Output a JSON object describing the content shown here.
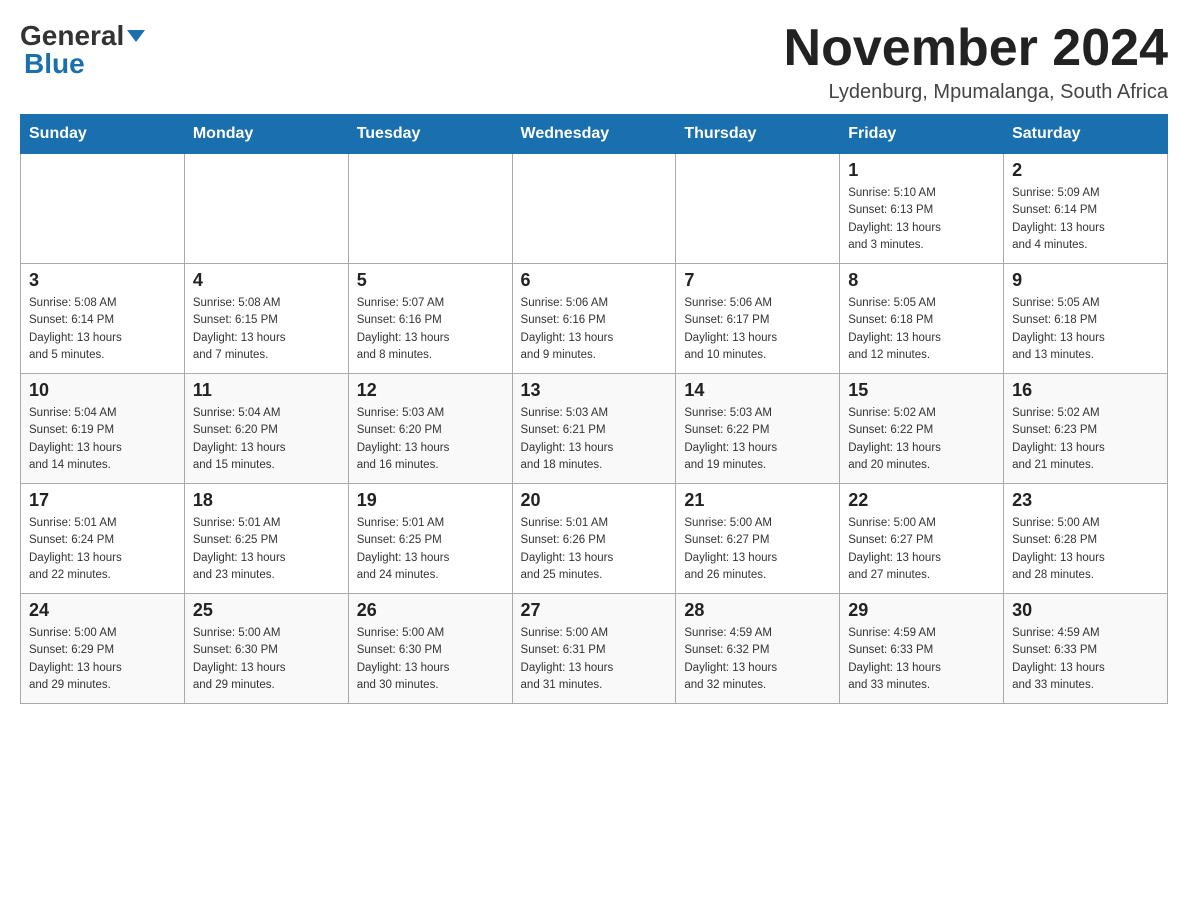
{
  "header": {
    "logo_general": "General",
    "logo_blue": "Blue",
    "month_title": "November 2024",
    "location": "Lydenburg, Mpumalanga, South Africa"
  },
  "weekdays": [
    "Sunday",
    "Monday",
    "Tuesday",
    "Wednesday",
    "Thursday",
    "Friday",
    "Saturday"
  ],
  "weeks": [
    [
      {
        "day": "",
        "info": ""
      },
      {
        "day": "",
        "info": ""
      },
      {
        "day": "",
        "info": ""
      },
      {
        "day": "",
        "info": ""
      },
      {
        "day": "",
        "info": ""
      },
      {
        "day": "1",
        "info": "Sunrise: 5:10 AM\nSunset: 6:13 PM\nDaylight: 13 hours\nand 3 minutes."
      },
      {
        "day": "2",
        "info": "Sunrise: 5:09 AM\nSunset: 6:14 PM\nDaylight: 13 hours\nand 4 minutes."
      }
    ],
    [
      {
        "day": "3",
        "info": "Sunrise: 5:08 AM\nSunset: 6:14 PM\nDaylight: 13 hours\nand 5 minutes."
      },
      {
        "day": "4",
        "info": "Sunrise: 5:08 AM\nSunset: 6:15 PM\nDaylight: 13 hours\nand 7 minutes."
      },
      {
        "day": "5",
        "info": "Sunrise: 5:07 AM\nSunset: 6:16 PM\nDaylight: 13 hours\nand 8 minutes."
      },
      {
        "day": "6",
        "info": "Sunrise: 5:06 AM\nSunset: 6:16 PM\nDaylight: 13 hours\nand 9 minutes."
      },
      {
        "day": "7",
        "info": "Sunrise: 5:06 AM\nSunset: 6:17 PM\nDaylight: 13 hours\nand 10 minutes."
      },
      {
        "day": "8",
        "info": "Sunrise: 5:05 AM\nSunset: 6:18 PM\nDaylight: 13 hours\nand 12 minutes."
      },
      {
        "day": "9",
        "info": "Sunrise: 5:05 AM\nSunset: 6:18 PM\nDaylight: 13 hours\nand 13 minutes."
      }
    ],
    [
      {
        "day": "10",
        "info": "Sunrise: 5:04 AM\nSunset: 6:19 PM\nDaylight: 13 hours\nand 14 minutes."
      },
      {
        "day": "11",
        "info": "Sunrise: 5:04 AM\nSunset: 6:20 PM\nDaylight: 13 hours\nand 15 minutes."
      },
      {
        "day": "12",
        "info": "Sunrise: 5:03 AM\nSunset: 6:20 PM\nDaylight: 13 hours\nand 16 minutes."
      },
      {
        "day": "13",
        "info": "Sunrise: 5:03 AM\nSunset: 6:21 PM\nDaylight: 13 hours\nand 18 minutes."
      },
      {
        "day": "14",
        "info": "Sunrise: 5:03 AM\nSunset: 6:22 PM\nDaylight: 13 hours\nand 19 minutes."
      },
      {
        "day": "15",
        "info": "Sunrise: 5:02 AM\nSunset: 6:22 PM\nDaylight: 13 hours\nand 20 minutes."
      },
      {
        "day": "16",
        "info": "Sunrise: 5:02 AM\nSunset: 6:23 PM\nDaylight: 13 hours\nand 21 minutes."
      }
    ],
    [
      {
        "day": "17",
        "info": "Sunrise: 5:01 AM\nSunset: 6:24 PM\nDaylight: 13 hours\nand 22 minutes."
      },
      {
        "day": "18",
        "info": "Sunrise: 5:01 AM\nSunset: 6:25 PM\nDaylight: 13 hours\nand 23 minutes."
      },
      {
        "day": "19",
        "info": "Sunrise: 5:01 AM\nSunset: 6:25 PM\nDaylight: 13 hours\nand 24 minutes."
      },
      {
        "day": "20",
        "info": "Sunrise: 5:01 AM\nSunset: 6:26 PM\nDaylight: 13 hours\nand 25 minutes."
      },
      {
        "day": "21",
        "info": "Sunrise: 5:00 AM\nSunset: 6:27 PM\nDaylight: 13 hours\nand 26 minutes."
      },
      {
        "day": "22",
        "info": "Sunrise: 5:00 AM\nSunset: 6:27 PM\nDaylight: 13 hours\nand 27 minutes."
      },
      {
        "day": "23",
        "info": "Sunrise: 5:00 AM\nSunset: 6:28 PM\nDaylight: 13 hours\nand 28 minutes."
      }
    ],
    [
      {
        "day": "24",
        "info": "Sunrise: 5:00 AM\nSunset: 6:29 PM\nDaylight: 13 hours\nand 29 minutes."
      },
      {
        "day": "25",
        "info": "Sunrise: 5:00 AM\nSunset: 6:30 PM\nDaylight: 13 hours\nand 29 minutes."
      },
      {
        "day": "26",
        "info": "Sunrise: 5:00 AM\nSunset: 6:30 PM\nDaylight: 13 hours\nand 30 minutes."
      },
      {
        "day": "27",
        "info": "Sunrise: 5:00 AM\nSunset: 6:31 PM\nDaylight: 13 hours\nand 31 minutes."
      },
      {
        "day": "28",
        "info": "Sunrise: 4:59 AM\nSunset: 6:32 PM\nDaylight: 13 hours\nand 32 minutes."
      },
      {
        "day": "29",
        "info": "Sunrise: 4:59 AM\nSunset: 6:33 PM\nDaylight: 13 hours\nand 33 minutes."
      },
      {
        "day": "30",
        "info": "Sunrise: 4:59 AM\nSunset: 6:33 PM\nDaylight: 13 hours\nand 33 minutes."
      }
    ]
  ]
}
